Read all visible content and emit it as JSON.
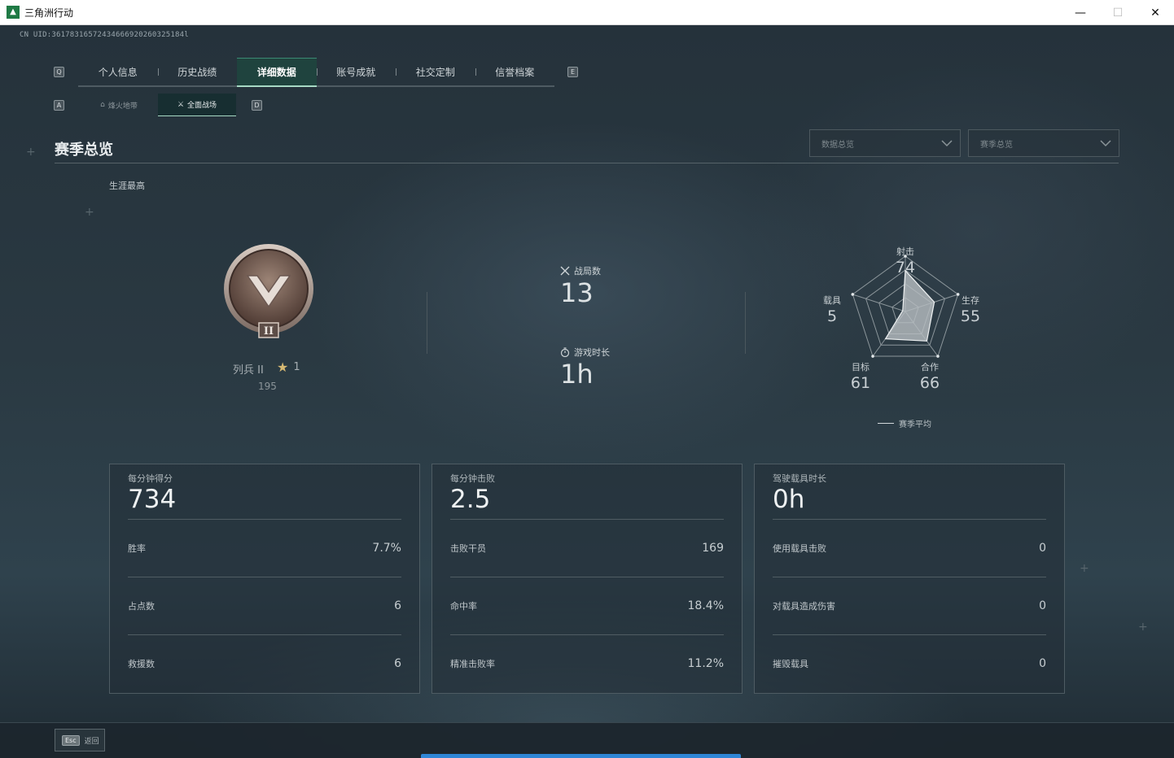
{
  "window": {
    "title": "三角洲行动",
    "minimize": "—",
    "maximize": "☐",
    "close": "✕"
  },
  "uid": "CN UID:36178316572434666920260325184l",
  "keys": {
    "tab_prev": "Q",
    "tab_next": "E",
    "sub_prev": "A",
    "sub_next": "D"
  },
  "tabs": [
    {
      "label": "个人信息"
    },
    {
      "label": "历史战绩"
    },
    {
      "label": "详细数据"
    },
    {
      "label": "账号成就"
    },
    {
      "label": "社交定制"
    },
    {
      "label": "信誉档案"
    }
  ],
  "active_tab_index": 2,
  "subtabs": [
    {
      "label": "烽火地带",
      "icon": "⌂"
    },
    {
      "label": "全面战场",
      "icon": "⚔"
    }
  ],
  "active_subtab_index": 1,
  "section": {
    "title": "赛季总览"
  },
  "dropdowns": [
    {
      "value": "数据总览"
    },
    {
      "value": "赛季总览"
    }
  ],
  "career": {
    "label": "生涯最高",
    "rank_name": "列兵 II",
    "rank_numeral": "II",
    "stars": "1",
    "points": "195"
  },
  "mid_stats": {
    "matches_label": "战局数",
    "matches_value": "13",
    "playtime_label": "游戏时长",
    "playtime_value": "1h"
  },
  "radar": {
    "axes": [
      {
        "label": "射击",
        "value": 74
      },
      {
        "label": "生存",
        "value": 55
      },
      {
        "label": "合作",
        "value": 66
      },
      {
        "label": "目标",
        "value": 61
      },
      {
        "label": "载具",
        "value": 5
      }
    ],
    "max": 100,
    "legend": "赛季平均",
    "colors": {
      "fill": "#b8bec2",
      "grid": "#8c969b"
    }
  },
  "cards": [
    {
      "head_label": "每分钟得分",
      "head_value": "734",
      "rows": [
        {
          "label": "胜率",
          "value": "7.7%"
        },
        {
          "label": "占点数",
          "value": "6"
        },
        {
          "label": "救援数",
          "value": "6"
        }
      ]
    },
    {
      "head_label": "每分钟击败",
      "head_value": "2.5",
      "rows": [
        {
          "label": "击败干员",
          "value": "169"
        },
        {
          "label": "命中率",
          "value": "18.4%"
        },
        {
          "label": "精准击败率",
          "value": "11.2%"
        }
      ]
    },
    {
      "head_label": "驾驶载具时长",
      "head_value": "0h",
      "rows": [
        {
          "label": "使用载具击败",
          "value": "0"
        },
        {
          "label": "对载具造成伤害",
          "value": "0"
        },
        {
          "label": "摧毁载具",
          "value": "0"
        }
      ]
    }
  ],
  "footer": {
    "esc_key": "Esc",
    "back_label": "返回"
  }
}
